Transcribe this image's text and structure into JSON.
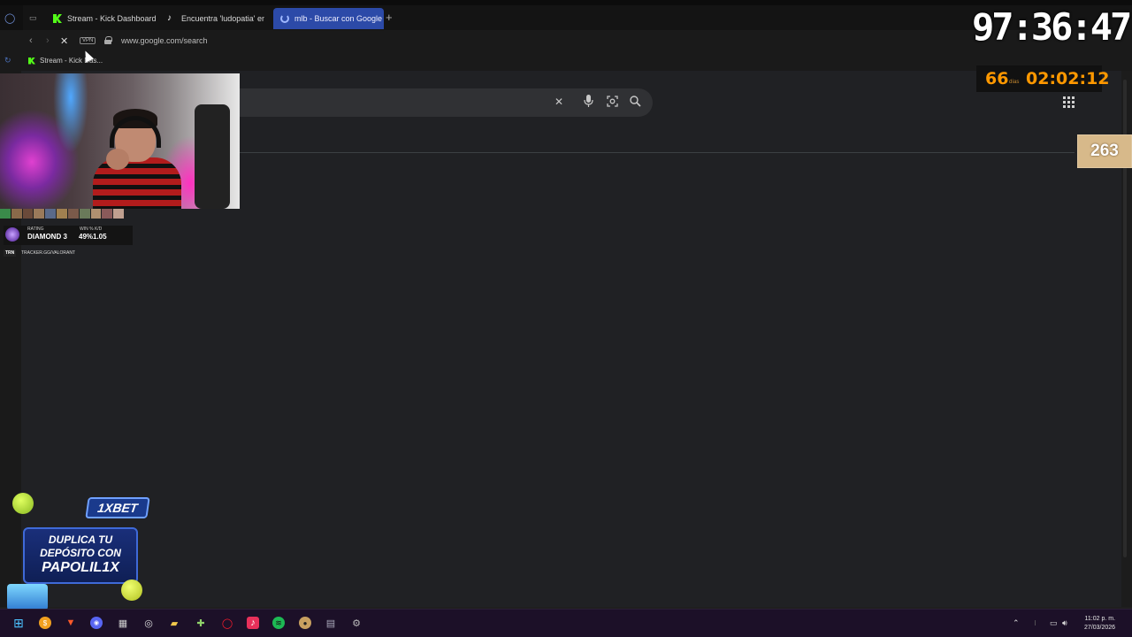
{
  "browser": {
    "tabs": [
      {
        "label": "Stream - Kick Dashboard",
        "icon": "kick-icon",
        "active": false
      },
      {
        "label": "Encuentra 'ludopatia' en T",
        "icon": "tiktok-icon",
        "active": false
      },
      {
        "label": "mlb - Buscar con Google",
        "icon": "loading-spinner-icon",
        "active": true
      }
    ],
    "new_tab": "+",
    "vpn_label": "VPN",
    "url": "www.google.com/search",
    "bookmark": "Stream - Kick Das..."
  },
  "search": {
    "clear_icon": "✕",
    "mic_icon": "🎤",
    "lens_icon": "⊡",
    "search_icon": "⌕"
  },
  "overlay": {
    "timer": "97:36:47",
    "days_count": "66",
    "days_label": "días",
    "days_time": "02:02:12",
    "counter": "263",
    "rating_label": "RATING",
    "rating_value": "DIAMOND 3",
    "win_kd_label": "WIN % K/D",
    "win_kd_value": "49%1.05",
    "trn": "TRN",
    "tracker_url": "TRACKER.GG/VALORANT"
  },
  "ad": {
    "logo": "1XBET",
    "line1": "DUPLICA TU",
    "line2": "DEPÓSITO CON",
    "line3": "PAPOLIL1X"
  },
  "taskbar": {
    "time": "11:02 p. m.",
    "date": "27/03/2026",
    "icons": [
      "windows-icon",
      "coin-icon",
      "brave-icon",
      "discord-icon",
      "store-icon",
      "obs-icon",
      "folder-icon",
      "gamepad-icon",
      "opera-icon",
      "tiktok-icon",
      "spotify-icon",
      "app-icon",
      "chat-icon",
      "settings-icon"
    ]
  },
  "colors": {
    "page_bg": "#202124",
    "tab_active": "#2c4aa8",
    "timer_orange": "#ff9800",
    "kick_green": "#53fc18"
  }
}
